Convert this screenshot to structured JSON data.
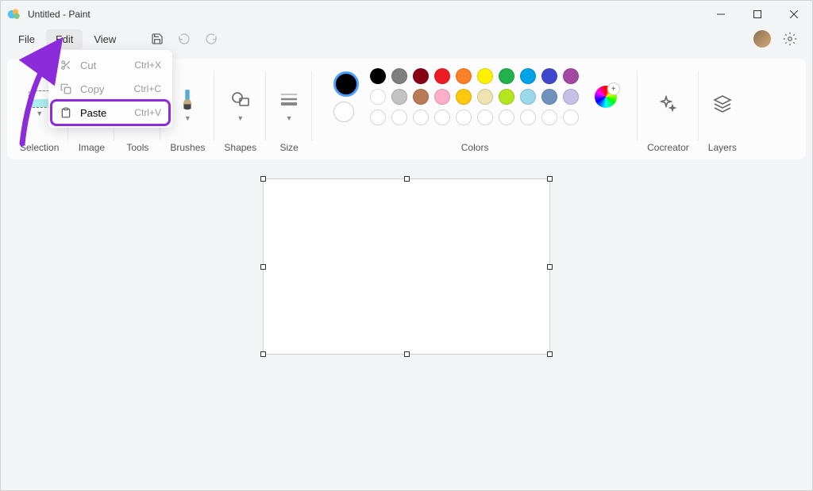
{
  "title": "Untitled - Paint",
  "menu": {
    "file": "File",
    "edit": "Edit",
    "view": "View"
  },
  "dropdown": {
    "cut": {
      "label": "Cut",
      "shortcut": "Ctrl+X"
    },
    "copy": {
      "label": "Copy",
      "shortcut": "Ctrl+C"
    },
    "paste": {
      "label": "Paste",
      "shortcut": "Ctrl+V"
    }
  },
  "ribbon": {
    "selection": "Selection",
    "image": "Image",
    "tools": "Tools",
    "brushes": "Brushes",
    "shapes": "Shapes",
    "size": "Size",
    "colors": "Colors",
    "cocreator": "Cocreator",
    "layers": "Layers"
  },
  "palette": {
    "row1": [
      "#000000",
      "#7f7f7f",
      "#880015",
      "#ed1c24",
      "#ff7f27",
      "#fff200",
      "#22b14c",
      "#00a2e8",
      "#3f48cc",
      "#a349a4"
    ],
    "row2": [
      "#ffffff",
      "#c3c3c3",
      "#b97a57",
      "#ffaec9",
      "#ffc90e",
      "#efe4b0",
      "#b5e61d",
      "#99d9ea",
      "#7092be",
      "#c8bfe7"
    ]
  }
}
